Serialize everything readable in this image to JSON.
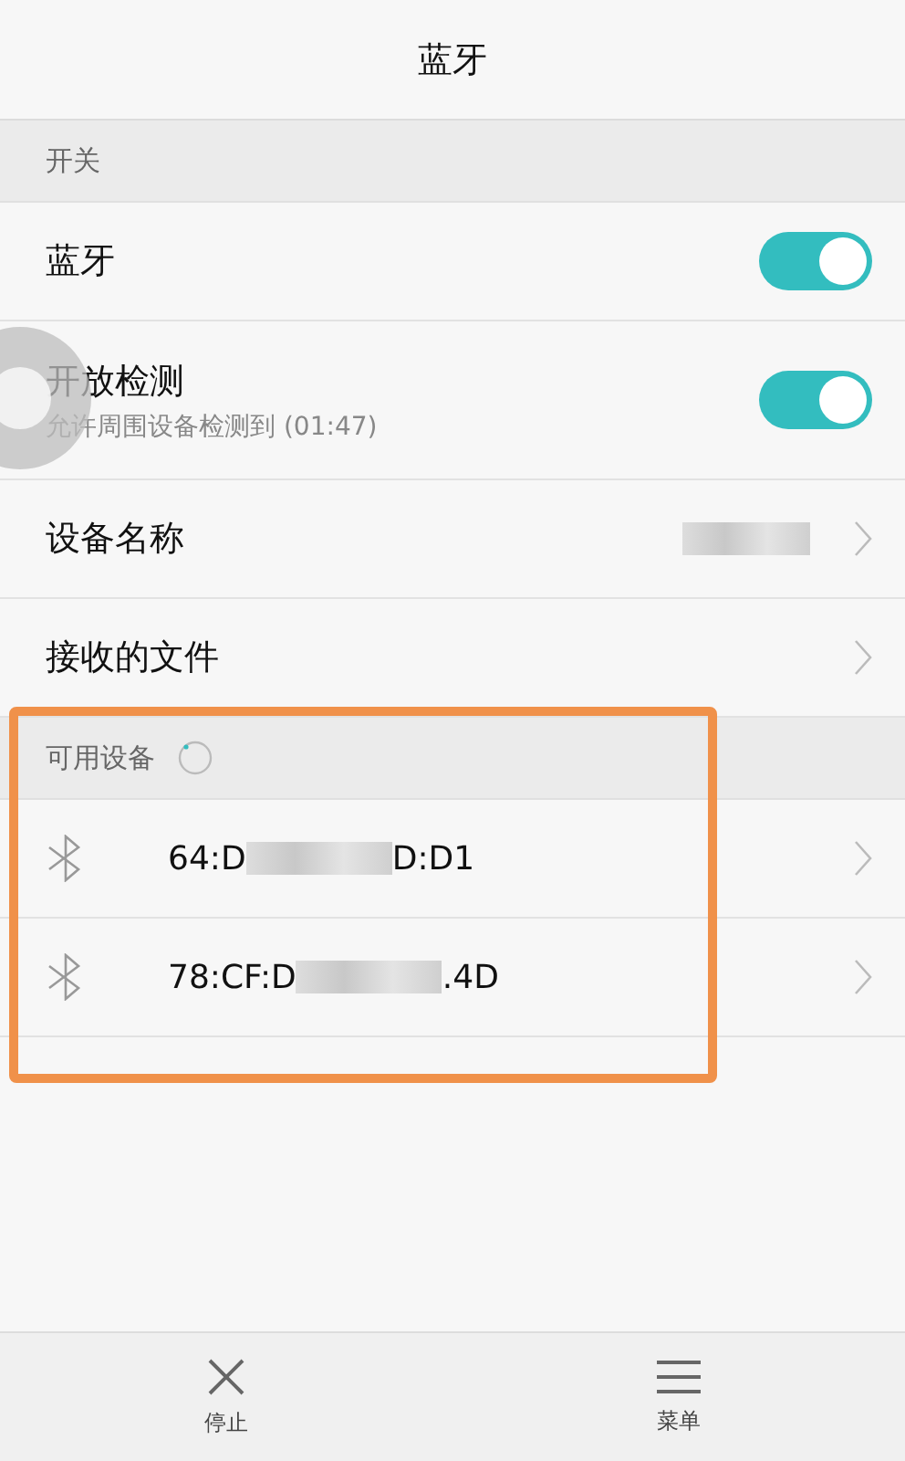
{
  "header": {
    "title": "蓝牙"
  },
  "switch_section": {
    "title": "开关",
    "items": [
      {
        "kind": "toggle",
        "label": "蓝牙",
        "on": true
      },
      {
        "kind": "toggle",
        "label": "开放检测",
        "subtitle": "允许周围设备检测到 (01:47)",
        "on": true
      },
      {
        "kind": "link",
        "label": "设备名称",
        "redacted_value": true
      },
      {
        "kind": "link",
        "label": "接收的文件"
      }
    ]
  },
  "devices_section": {
    "title": "可用设备",
    "scanning": true,
    "devices": [
      {
        "prefix": "64:D",
        "suffix": "D:D1"
      },
      {
        "prefix": "78:CF:D",
        "suffix": ".4D"
      }
    ]
  },
  "bottom_bar": [
    {
      "kind": "close",
      "label": "停止"
    },
    {
      "kind": "menu",
      "label": "菜单"
    }
  ]
}
